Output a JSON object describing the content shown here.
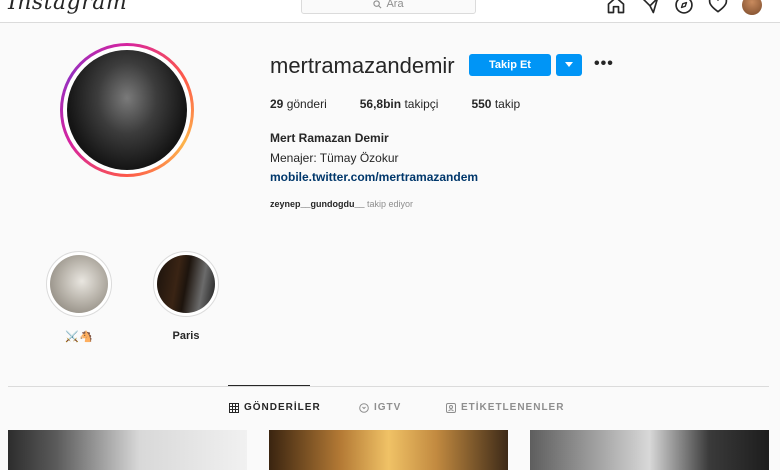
{
  "topbar": {
    "logo": "Instagram",
    "search_placeholder": "Ara",
    "nav_icons": [
      "home-icon",
      "direct-message-icon",
      "explore-icon",
      "heart-icon",
      "profile-avatar"
    ]
  },
  "profile": {
    "username": "mertramazandemir",
    "follow_label": "Takip Et",
    "posts_count": "29",
    "posts_label": "gönderi",
    "followers_count": "56,8bin",
    "followers_label": "takipçi",
    "following_count": "550",
    "following_label": "takip",
    "full_name": "Mert Ramazan Demir",
    "bio": "Menajer: Tümay Özokur",
    "link": "mobile.twitter.com/mertramazandem",
    "followed_by_user": "zeynep__gundogdu__",
    "followed_by_suffix": "takip ediyor"
  },
  "highlights": [
    {
      "label": "⚔️🐴"
    },
    {
      "label": "Paris"
    }
  ],
  "tabs": [
    {
      "label": "GÖNDERİLER",
      "active": true,
      "icon": "grid-icon"
    },
    {
      "label": "IGTV",
      "active": false,
      "icon": "igtv-icon"
    },
    {
      "label": "ETİKETLENENLER",
      "active": false,
      "icon": "tagged-icon"
    }
  ],
  "colors": {
    "accent": "#0095f6",
    "link": "#00376b",
    "muted": "#8e8e8e",
    "notification": "#ed4956"
  }
}
